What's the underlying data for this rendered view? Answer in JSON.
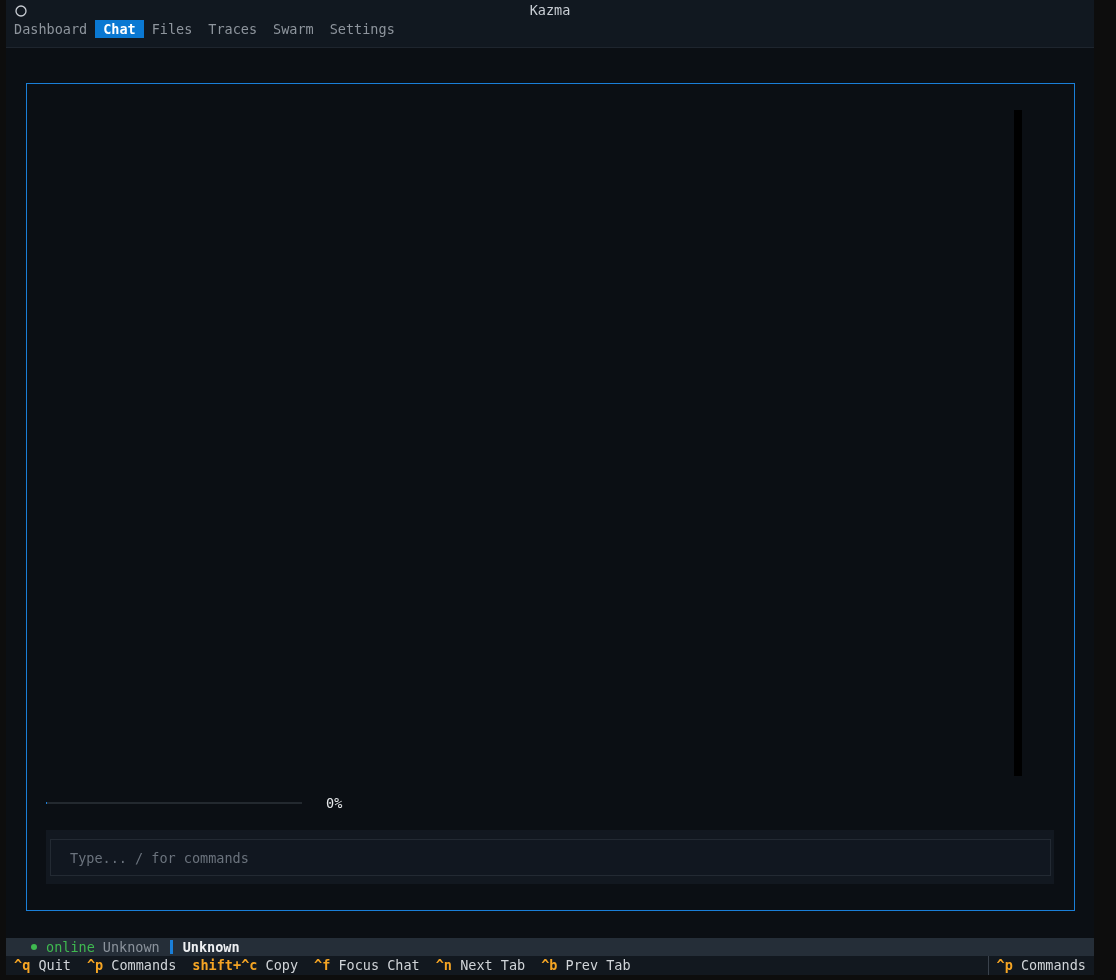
{
  "window": {
    "title": "Kazma"
  },
  "tabs": [
    {
      "label": "Dashboard",
      "selected": false
    },
    {
      "label": "Chat",
      "selected": true
    },
    {
      "label": "Files",
      "selected": false
    },
    {
      "label": "Traces",
      "selected": false
    },
    {
      "label": "Swarm",
      "selected": false
    },
    {
      "label": "Settings",
      "selected": false
    }
  ],
  "chat": {
    "progress": {
      "level": 0,
      "reading": "0%"
    },
    "input": {
      "placeholder": "Type... / for commands"
    }
  },
  "status_bar": {
    "connection": {
      "label": "online",
      "online": true
    },
    "detail": "Unknown",
    "title": "Unknown"
  },
  "footer": {
    "bindings": [
      {
        "key": "^q",
        "label": "Quit"
      },
      {
        "key": "^p",
        "label": "Commands"
      },
      {
        "key": "shift+^c",
        "label": "Copy"
      },
      {
        "key": "^f",
        "label": "Focus Chat"
      },
      {
        "key": "^n",
        "label": "Next Tab"
      },
      {
        "key": "^b",
        "label": "Prev Tab"
      }
    ],
    "right_binding": {
      "key": "^p",
      "label": "Commands"
    }
  }
}
